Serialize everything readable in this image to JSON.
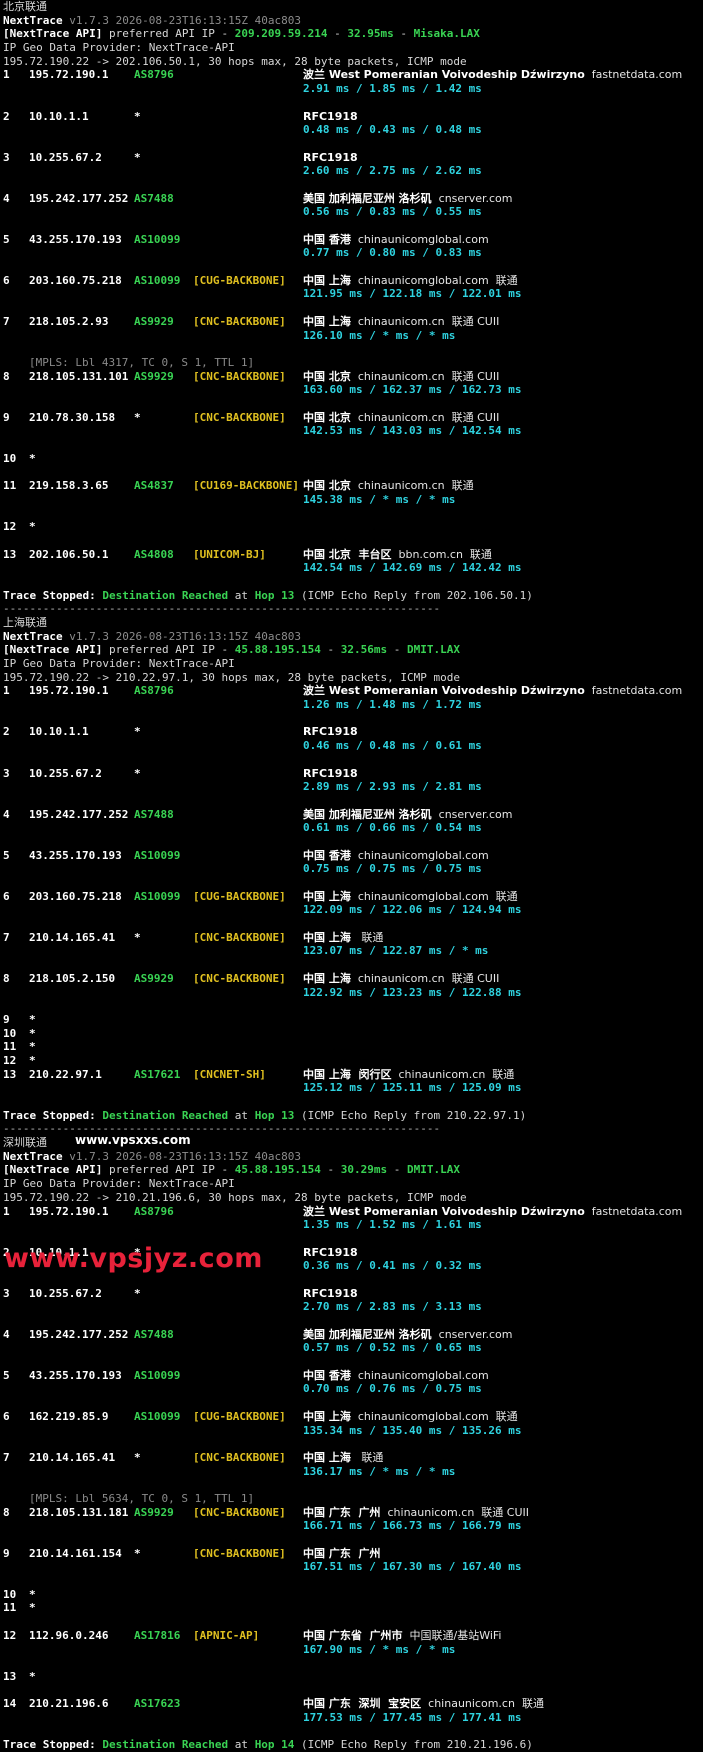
{
  "meta": {
    "version": "v1.7.3 2026-08-23T16:13:15Z 40ac803",
    "geo_provider": "IP Geo Data Provider: NextTrace-API",
    "stopped_label": "Trace Stopped:",
    "dest_label": "Destination Reached",
    "at_hop": "at",
    "separator": "------------------------------------------------------------------"
  },
  "watermarks": {
    "mid": "www.vpsxxs.com",
    "big": "www.vpsjyz.com"
  },
  "traces": [
    {
      "title": "北京联通",
      "api": "[NextTrace API]",
      "api_text": " preferred API IP - ",
      "api_ip": "209.209.59.214",
      "api_rtt": "32.95ms",
      "api_node": "Misaka.LAX",
      "route": "195.72.190.22 -> 202.106.50.1, 30 hops max, 28 byte packets, ICMP mode",
      "hops": [
        {
          "n": "1",
          "ip": "195.72.190.1",
          "as": "AS8796",
          "tag": "",
          "geo": "波兰 West Pomeranian Voivodeship Dźwirzyno",
          "host": "fastnetdata.com",
          "rtt": "2.91 ms / 1.85 ms / 1.42 ms"
        },
        {
          "n": "2",
          "ip": "10.10.1.1",
          "as": "*",
          "tag": "",
          "geo": "RFC1918",
          "host": "",
          "rtt": "0.48 ms / 0.43 ms / 0.48 ms"
        },
        {
          "n": "3",
          "ip": "10.255.67.2",
          "as": "*",
          "tag": "",
          "geo": "RFC1918",
          "host": "",
          "rtt": "2.60 ms / 2.75 ms / 2.62 ms"
        },
        {
          "n": "4",
          "ip": "195.242.177.252",
          "as": "AS7488",
          "tag": "",
          "geo": "美国 加利福尼亚州 洛杉矶",
          "host": "cnserver.com",
          "rtt": "0.56 ms / 0.83 ms / 0.55 ms"
        },
        {
          "n": "5",
          "ip": "43.255.170.193",
          "as": "AS10099",
          "tag": "",
          "geo": "中国 香港",
          "host": "chinaunicomglobal.com",
          "rtt": "0.77 ms / 0.80 ms / 0.83 ms"
        },
        {
          "n": "6",
          "ip": "203.160.75.218",
          "as": "AS10099",
          "tag": "[CUG-BACKBONE]",
          "geo": "中国 上海",
          "host": "chinaunicomglobal.com  联通",
          "rtt": "121.95 ms / 122.18 ms / 122.01 ms"
        },
        {
          "n": "7",
          "ip": "218.105.2.93",
          "as": "AS9929",
          "tag": "[CNC-BACKBONE]",
          "geo": "中国 上海",
          "host": "chinaunicom.cn  联通 CUII",
          "rtt": "126.10 ms / * ms / * ms"
        },
        {
          "n": "8",
          "ip": "218.105.131.101",
          "as": "AS9929",
          "tag": "[CNC-BACKBONE]",
          "geo": "中国 北京",
          "host": "chinaunicom.cn  联通 CUII",
          "rtt": "163.60 ms / 162.37 ms / 162.73 ms",
          "mpls": "[MPLS: Lbl 4317, TC 0, S 1, TTL 1]"
        },
        {
          "n": "9",
          "ip": "210.78.30.158",
          "as": "*",
          "tag": "[CNC-BACKBONE]",
          "geo": "中国 北京",
          "host": "chinaunicom.cn  联通 CUII",
          "rtt": "142.53 ms / 143.03 ms / 142.54 ms"
        },
        {
          "n": "10",
          "ip": "*",
          "star": true
        },
        {
          "n": "11",
          "ip": "219.158.3.65",
          "as": "AS4837",
          "tag": "[CU169-BACKBONE]",
          "geo": "中国 北京",
          "host": "chinaunicom.cn  联通",
          "rtt": "145.38 ms / * ms / * ms"
        },
        {
          "n": "12",
          "ip": "*",
          "star": true
        },
        {
          "n": "13",
          "ip": "202.106.50.1",
          "as": "AS4808",
          "tag": "[UNICOM-BJ]",
          "geo": "中国 北京  丰台区",
          "host": "bbn.com.cn  联通",
          "rtt": "142.54 ms / 142.69 ms / 142.42 ms"
        }
      ],
      "stop_hop": "Hop 13",
      "stop_tail": " (ICMP Echo Reply from 202.106.50.1)"
    },
    {
      "title": "上海联通",
      "api": "[NextTrace API]",
      "api_text": " preferred API IP - ",
      "api_ip": "45.88.195.154",
      "api_rtt": "32.56ms",
      "api_node": "DMIT.LAX",
      "route": "195.72.190.22 -> 210.22.97.1, 30 hops max, 28 byte packets, ICMP mode",
      "hops": [
        {
          "n": "1",
          "ip": "195.72.190.1",
          "as": "AS8796",
          "tag": "",
          "geo": "波兰 West Pomeranian Voivodeship Dźwirzyno",
          "host": "fastnetdata.com",
          "rtt": "1.26 ms / 1.48 ms / 1.72 ms"
        },
        {
          "n": "2",
          "ip": "10.10.1.1",
          "as": "*",
          "tag": "",
          "geo": "RFC1918",
          "host": "",
          "rtt": "0.46 ms / 0.48 ms / 0.61 ms"
        },
        {
          "n": "3",
          "ip": "10.255.67.2",
          "as": "*",
          "tag": "",
          "geo": "RFC1918",
          "host": "",
          "rtt": "2.89 ms / 2.93 ms / 2.81 ms"
        },
        {
          "n": "4",
          "ip": "195.242.177.252",
          "as": "AS7488",
          "tag": "",
          "geo": "美国 加利福尼亚州 洛杉矶",
          "host": "cnserver.com",
          "rtt": "0.61 ms / 0.66 ms / 0.54 ms"
        },
        {
          "n": "5",
          "ip": "43.255.170.193",
          "as": "AS10099",
          "tag": "",
          "geo": "中国 香港",
          "host": "chinaunicomglobal.com",
          "rtt": "0.75 ms / 0.75 ms / 0.75 ms"
        },
        {
          "n": "6",
          "ip": "203.160.75.218",
          "as": "AS10099",
          "tag": "[CUG-BACKBONE]",
          "geo": "中国 上海",
          "host": "chinaunicomglobal.com  联通",
          "rtt": "122.09 ms / 122.06 ms / 124.94 ms"
        },
        {
          "n": "7",
          "ip": "210.14.165.41",
          "as": "*",
          "tag": "[CNC-BACKBONE]",
          "geo": "中国 上海",
          "host": " 联通",
          "rtt": "123.07 ms / 122.87 ms / * ms"
        },
        {
          "n": "8",
          "ip": "218.105.2.150",
          "as": "AS9929",
          "tag": "[CNC-BACKBONE]",
          "geo": "中国 上海",
          "host": "chinaunicom.cn  联通 CUII",
          "rtt": "122.92 ms / 123.23 ms / 122.88 ms"
        },
        {
          "n": "9",
          "ip": "*",
          "star": true,
          "tight": true
        },
        {
          "n": "10",
          "ip": "*",
          "star": true,
          "tight": true
        },
        {
          "n": "11",
          "ip": "*",
          "star": true,
          "tight": true
        },
        {
          "n": "12",
          "ip": "*",
          "star": true,
          "tight": true
        },
        {
          "n": "13",
          "ip": "210.22.97.1",
          "as": "AS17621",
          "tag": "[CNCNET-SH]",
          "geo": "中国 上海  闵行区",
          "host": "chinaunicom.cn  联通",
          "rtt": "125.12 ms / 125.11 ms / 125.09 ms"
        }
      ],
      "stop_hop": "Hop 13",
      "stop_tail": " (ICMP Echo Reply from 210.22.97.1)"
    },
    {
      "title": "深圳联通",
      "api": "[NextTrace API]",
      "api_text": " preferred API IP - ",
      "api_ip": "45.88.195.154",
      "api_rtt": "30.29ms",
      "api_node": "DMIT.LAX",
      "route": "195.72.190.22 -> 210.21.196.6, 30 hops max, 28 byte packets, ICMP mode",
      "hops": [
        {
          "n": "1",
          "ip": "195.72.190.1",
          "as": "AS8796",
          "tag": "",
          "geo": "波兰 West Pomeranian Voivodeship Dźwirzyno",
          "host": "fastnetdata.com",
          "rtt": "1.35 ms / 1.52 ms / 1.61 ms"
        },
        {
          "n": "2",
          "ip": "10.10.1.1",
          "as": "*",
          "tag": "",
          "geo": "RFC1918",
          "host": "",
          "rtt": "0.36 ms / 0.41 ms / 0.32 ms"
        },
        {
          "n": "3",
          "ip": "10.255.67.2",
          "as": "*",
          "tag": "",
          "geo": "RFC1918",
          "host": "",
          "rtt": "2.70 ms / 2.83 ms / 3.13 ms"
        },
        {
          "n": "4",
          "ip": "195.242.177.252",
          "as": "AS7488",
          "tag": "",
          "geo": "美国 加利福尼亚州 洛杉矶",
          "host": "cnserver.com",
          "rtt": "0.57 ms / 0.52 ms / 0.65 ms"
        },
        {
          "n": "5",
          "ip": "43.255.170.193",
          "as": "AS10099",
          "tag": "",
          "geo": "中国 香港",
          "host": "chinaunicomglobal.com",
          "rtt": "0.70 ms / 0.76 ms / 0.75 ms"
        },
        {
          "n": "6",
          "ip": "162.219.85.9",
          "as": "AS10099",
          "tag": "[CUG-BACKBONE]",
          "geo": "中国 上海",
          "host": "chinaunicomglobal.com  联通",
          "rtt": "135.34 ms / 135.40 ms / 135.26 ms"
        },
        {
          "n": "7",
          "ip": "210.14.165.41",
          "as": "*",
          "tag": "[CNC-BACKBONE]",
          "geo": "中国 上海",
          "host": " 联通",
          "rtt": "136.17 ms / * ms / * ms"
        },
        {
          "n": "8",
          "ip": "218.105.131.181",
          "as": "AS9929",
          "tag": "[CNC-BACKBONE]",
          "geo": "中国 广东  广州",
          "host": "chinaunicom.cn  联通 CUII",
          "rtt": "166.71 ms / 166.73 ms / 166.79 ms",
          "mpls": "[MPLS: Lbl 5634, TC 0, S 1, TTL 1]"
        },
        {
          "n": "9",
          "ip": "210.14.161.154",
          "as": "*",
          "tag": "[CNC-BACKBONE]",
          "geo": "中国 广东  广州",
          "host": "",
          "rtt": "167.51 ms / 167.30 ms / 167.40 ms"
        },
        {
          "n": "10",
          "ip": "*",
          "star": true,
          "tight": true
        },
        {
          "n": "11",
          "ip": "*",
          "star": true
        },
        {
          "n": "12",
          "ip": "112.96.0.246",
          "as": "AS17816",
          "tag": "[APNIC-AP]",
          "geo": "中国 广东省  广州市",
          "host": "中国联通/基站WiFi",
          "rtt": "167.90 ms / * ms / * ms"
        },
        {
          "n": "13",
          "ip": "*",
          "star": true
        },
        {
          "n": "14",
          "ip": "210.21.196.6",
          "as": "AS17623",
          "tag": "",
          "geo": "中国 广东  深圳  宝安区",
          "host": "chinaunicom.cn  联通",
          "rtt": "177.53 ms / 177.45 ms / 177.41 ms"
        }
      ],
      "stop_hop": "Hop 14",
      "stop_tail": " (ICMP Echo Reply from 210.21.196.6)"
    }
  ]
}
